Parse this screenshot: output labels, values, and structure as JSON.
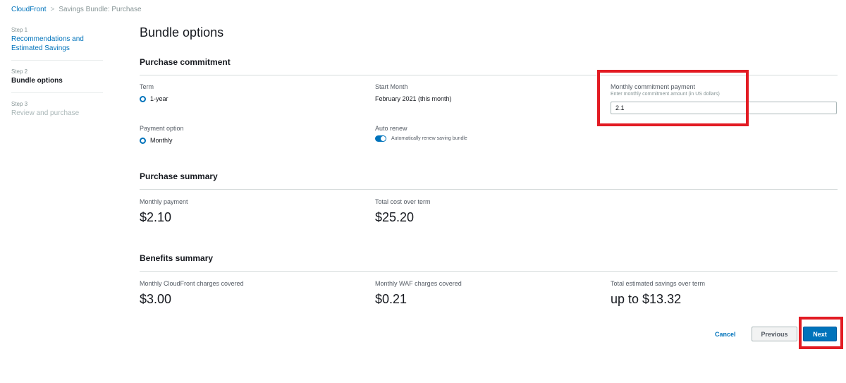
{
  "breadcrumb": {
    "root": "CloudFront",
    "separator": ">",
    "current": "Savings Bundle: Purchase"
  },
  "nav": {
    "steps": [
      {
        "number": "Step 1",
        "label": "Recommendations and Estimated Savings",
        "state": "link"
      },
      {
        "number": "Step 2",
        "label": "Bundle options",
        "state": "current"
      },
      {
        "number": "Step 3",
        "label": "Review and purchase",
        "state": "disabled"
      }
    ]
  },
  "page": {
    "title": "Bundle options"
  },
  "commitment": {
    "title": "Purchase commitment",
    "term_label": "Term",
    "term_value": "1-year",
    "start_label": "Start Month",
    "start_value": "February 2021 (this month)",
    "monthly_label": "Monthly commitment payment",
    "monthly_hint": "Enter monthly commitment amount (in US dollars)",
    "monthly_value": "2.1",
    "payment_label": "Payment option",
    "payment_value": "Monthly",
    "renew_label": "Auto renew",
    "renew_text": "Automatically renew saving bundle"
  },
  "summary": {
    "title": "Purchase summary",
    "monthly_label": "Monthly payment",
    "monthly_value": "$2.10",
    "total_label": "Total cost over term",
    "total_value": "$25.20"
  },
  "benefits": {
    "title": "Benefits summary",
    "cf_label": "Monthly CloudFront charges covered",
    "cf_value": "$3.00",
    "waf_label": "Monthly WAF charges covered",
    "waf_value": "$0.21",
    "savings_label": "Total estimated savings over term",
    "savings_value": "up to $13.32"
  },
  "actions": {
    "cancel": "Cancel",
    "previous": "Previous",
    "next": "Next"
  },
  "colors": {
    "accent": "#0073bb",
    "highlight": "#e21b23"
  }
}
